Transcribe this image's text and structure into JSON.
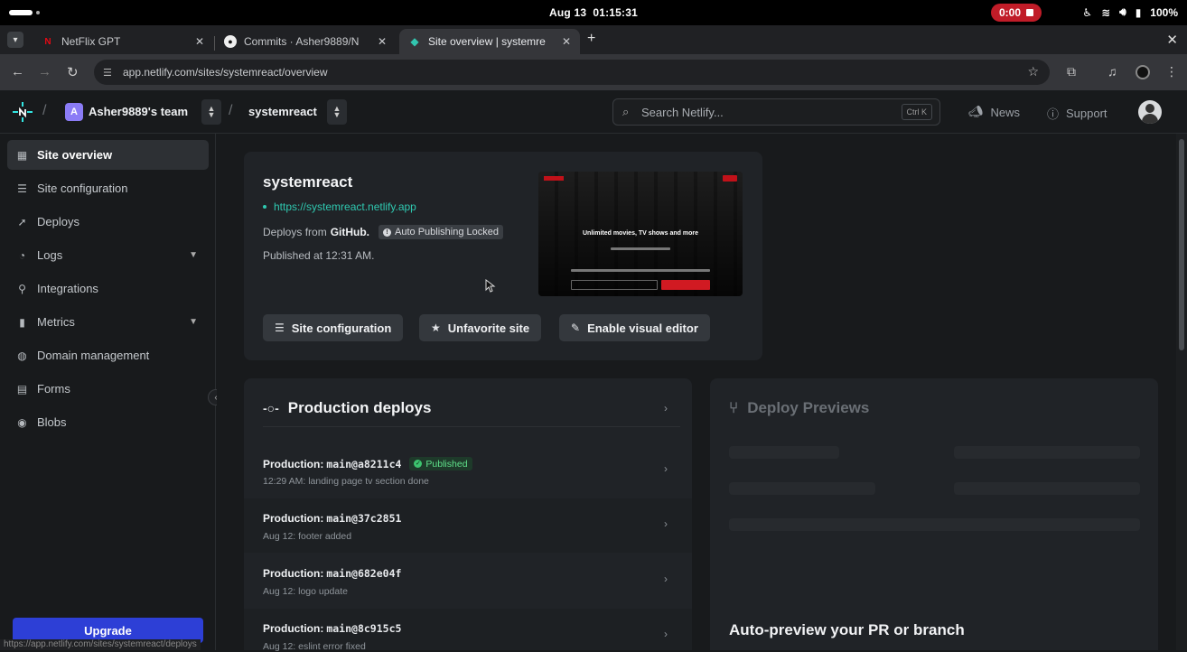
{
  "system": {
    "date": "Aug 13",
    "time": "01:15:31",
    "recording": "0:00",
    "battery": "100%"
  },
  "browser": {
    "tabs": [
      {
        "title": "NetFlix GPT",
        "icon": "netflix-icon",
        "active": false
      },
      {
        "title": "Commits · Asher9889/N",
        "icon": "github-icon",
        "active": false
      },
      {
        "title": "Site overview | systemre",
        "icon": "netlify-icon",
        "active": true
      }
    ],
    "url": "app.netlify.com/sites/systemreact/overview",
    "status_url": "https://app.netlify.com/sites/systemreact/deploys"
  },
  "header": {
    "team_initial": "A",
    "team_name": "Asher9889's team",
    "site_name": "systemreact",
    "search_placeholder": "Search Netlify...",
    "search_shortcut": "Ctrl K",
    "news": "News",
    "support": "Support"
  },
  "sidebar": {
    "items": [
      {
        "label": "Site overview",
        "icon": "grid-icon",
        "active": true,
        "expandable": false
      },
      {
        "label": "Site configuration",
        "icon": "settings-icon",
        "active": false,
        "expandable": false
      },
      {
        "label": "Deploys",
        "icon": "rocket-icon",
        "active": false,
        "expandable": false
      },
      {
        "label": "Logs",
        "icon": "logs-icon",
        "active": false,
        "expandable": true
      },
      {
        "label": "Integrations",
        "icon": "plug-icon",
        "active": false,
        "expandable": false
      },
      {
        "label": "Metrics",
        "icon": "chart-icon",
        "active": false,
        "expandable": true
      },
      {
        "label": "Domain management",
        "icon": "globe-icon",
        "active": false,
        "expandable": false
      },
      {
        "label": "Forms",
        "icon": "forms-icon",
        "active": false,
        "expandable": false
      },
      {
        "label": "Blobs",
        "icon": "blobs-icon",
        "active": false,
        "expandable": false
      }
    ],
    "upgrade": "Upgrade"
  },
  "overview": {
    "title": "systemreact",
    "url": "https://systemreact.netlify.app",
    "deploys_from_prefix": "Deploys from",
    "deploys_from_source": "GitHub.",
    "lock_badge": "Auto Publishing Locked",
    "published_at": "Published at 12:31 AM.",
    "thumbnail_headline": "Unlimited movies, TV shows and more",
    "buttons": {
      "site_config": "Site configuration",
      "unfavorite": "Unfavorite site",
      "visual_editor": "Enable visual editor"
    }
  },
  "production": {
    "title": "Production deploys",
    "prefix": "Production:",
    "published_badge": "Published",
    "deploys": [
      {
        "ref": "main@a8211c4",
        "subtitle": "12:29 AM: landing page tv section done",
        "published": true
      },
      {
        "ref": "main@37c2851",
        "subtitle": "Aug 12: footer added",
        "published": false
      },
      {
        "ref": "main@682e04f",
        "subtitle": "Aug 12: logo update",
        "published": false
      },
      {
        "ref": "main@8c915c5",
        "subtitle": "Aug 12: eslint error fixed",
        "published": false
      }
    ]
  },
  "previews": {
    "title": "Deploy Previews",
    "cta": "Auto-preview your PR or branch"
  }
}
